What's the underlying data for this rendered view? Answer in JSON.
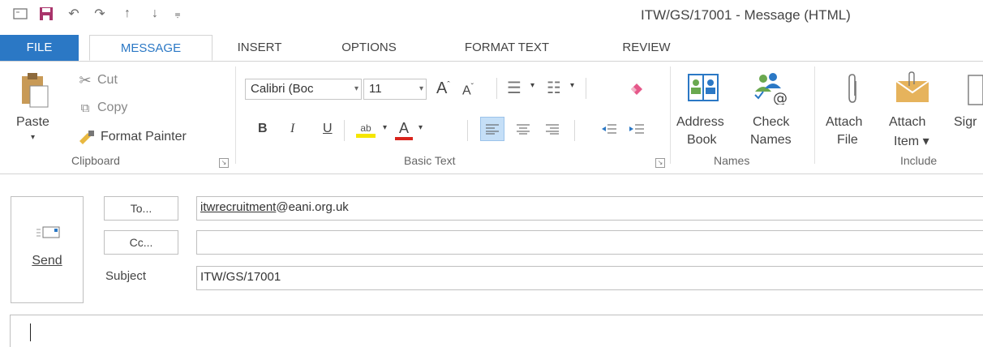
{
  "window": {
    "title": "ITW/GS/17001 - Message (HTML)",
    "qat_icons": [
      "message-icon",
      "save-icon",
      "undo-icon",
      "redo-icon",
      "up-arrow-icon",
      "down-arrow-icon",
      "customize-qat-icon"
    ]
  },
  "tabs": [
    {
      "label": "FILE"
    },
    {
      "label": "MESSAGE"
    },
    {
      "label": "INSERT"
    },
    {
      "label": "OPTIONS"
    },
    {
      "label": "FORMAT TEXT"
    },
    {
      "label": "REVIEW"
    }
  ],
  "clipboard": {
    "paste": "Paste",
    "cut": "Cut",
    "copy": "Copy",
    "format_painter": "Format Painter",
    "group_label": "Clipboard"
  },
  "basic_text": {
    "font_name": "Calibri (Boc",
    "font_size": "11",
    "bold": "B",
    "italic": "I",
    "underline": "U",
    "font_color_letter": "A",
    "grow_font": "A",
    "shrink_font": "A",
    "highlight_letters": "ab",
    "group_label": "Basic Text",
    "highlight_color": "#f5e600",
    "font_color": "#d9241c"
  },
  "names": {
    "address_book_line1": "Address",
    "address_book_line2": "Book",
    "check_names_line1": "Check",
    "check_names_line2": "Names",
    "group_label": "Names"
  },
  "include": {
    "attach_file_line1": "Attach",
    "attach_file_line2": "File",
    "attach_item_line1": "Attach",
    "attach_item_line2": "Item ▾",
    "signature_partial": "Sigr",
    "group_label": "Include"
  },
  "compose": {
    "send_label": "Send",
    "to_button": "To...",
    "cc_button": "Cc...",
    "subject_label": "Subject",
    "to_value": "itwrecruitment@eani.org.uk",
    "to_value_underlined": "itwrecruitment",
    "to_value_rest": "@eani.org.uk",
    "cc_value": "",
    "subject_value": "ITW/GS/17001"
  },
  "colors": {
    "accent": "#2b78c5",
    "file_tab_bg": "#2b78c5",
    "selected_align_bg": "#c5dff7"
  }
}
